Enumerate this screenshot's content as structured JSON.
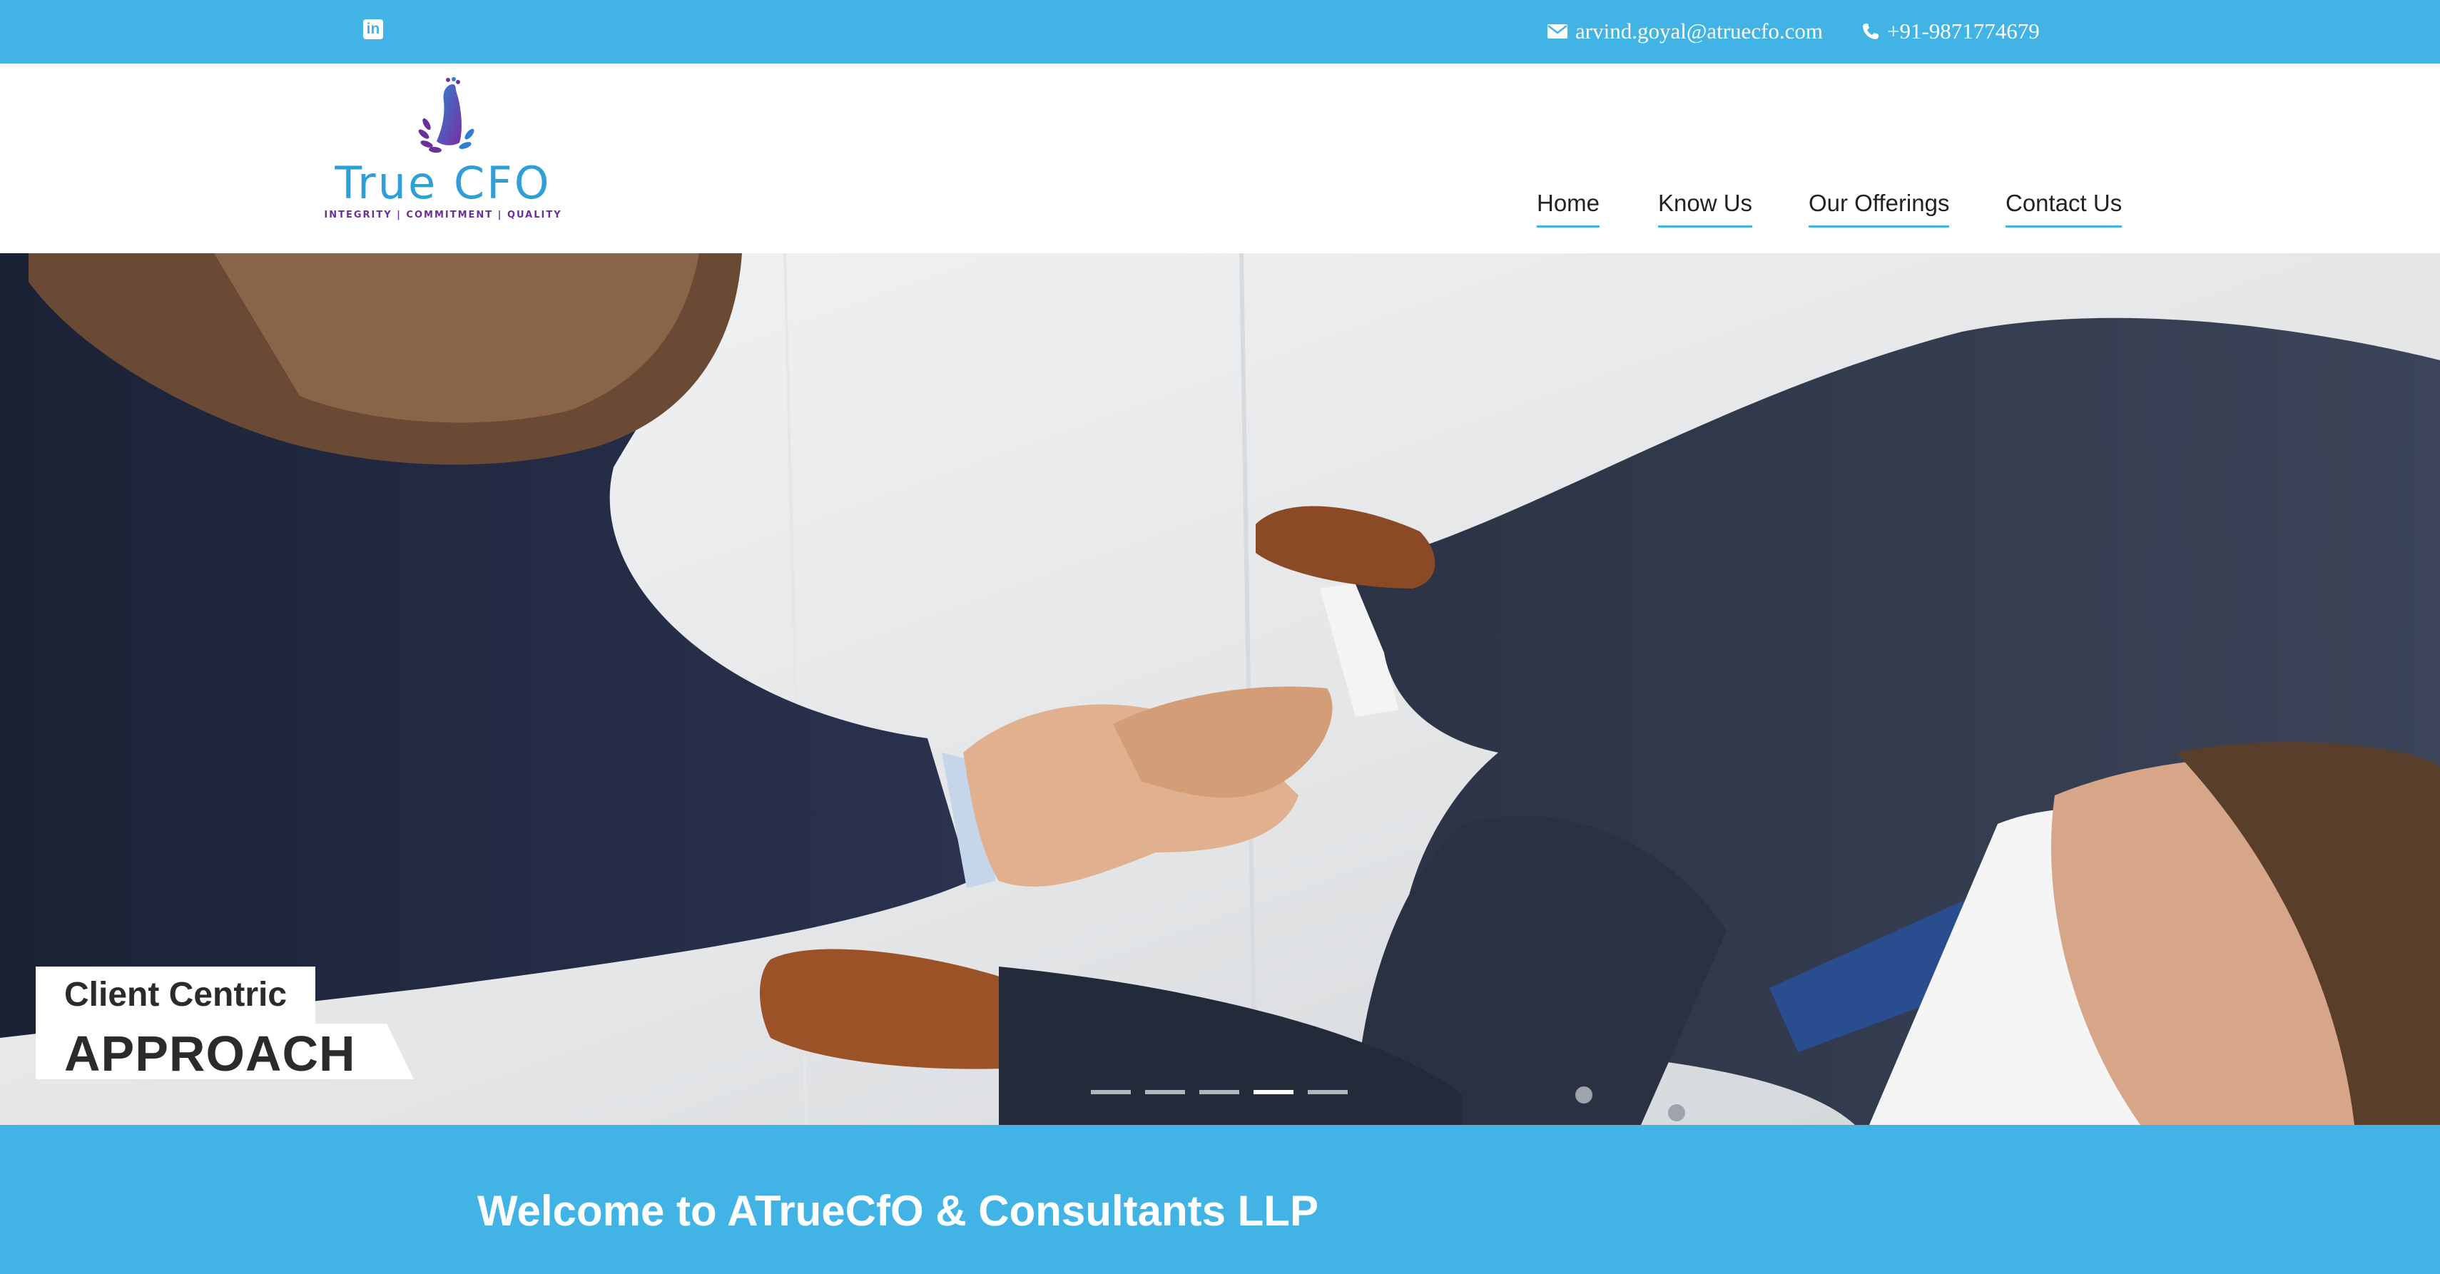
{
  "topbar": {
    "linkedin_icon": "linkedin-icon",
    "email": "arvind.goyal@atruecfo.com",
    "phone": "+91-9871774679",
    "background_color": "#42b3e5"
  },
  "header": {
    "logo": {
      "wordmark": "True CFO",
      "tagline": "INTEGRITY | COMMITMENT | QUALITY"
    },
    "nav": [
      {
        "label": "Home"
      },
      {
        "label": "Know Us"
      },
      {
        "label": "Our Offerings"
      },
      {
        "label": "Contact Us"
      }
    ]
  },
  "hero": {
    "caption_line1": "Client Centric",
    "caption_line2": "APPROACH",
    "slide_count": 5,
    "active_slide": 4
  },
  "welcome": {
    "heading": "Welcome to ATrueCfO & Consultants LLP"
  },
  "colors": {
    "accent": "#42b3e5",
    "logo_blue": "#2f9fd6",
    "logo_purple": "#6a2f9a"
  }
}
